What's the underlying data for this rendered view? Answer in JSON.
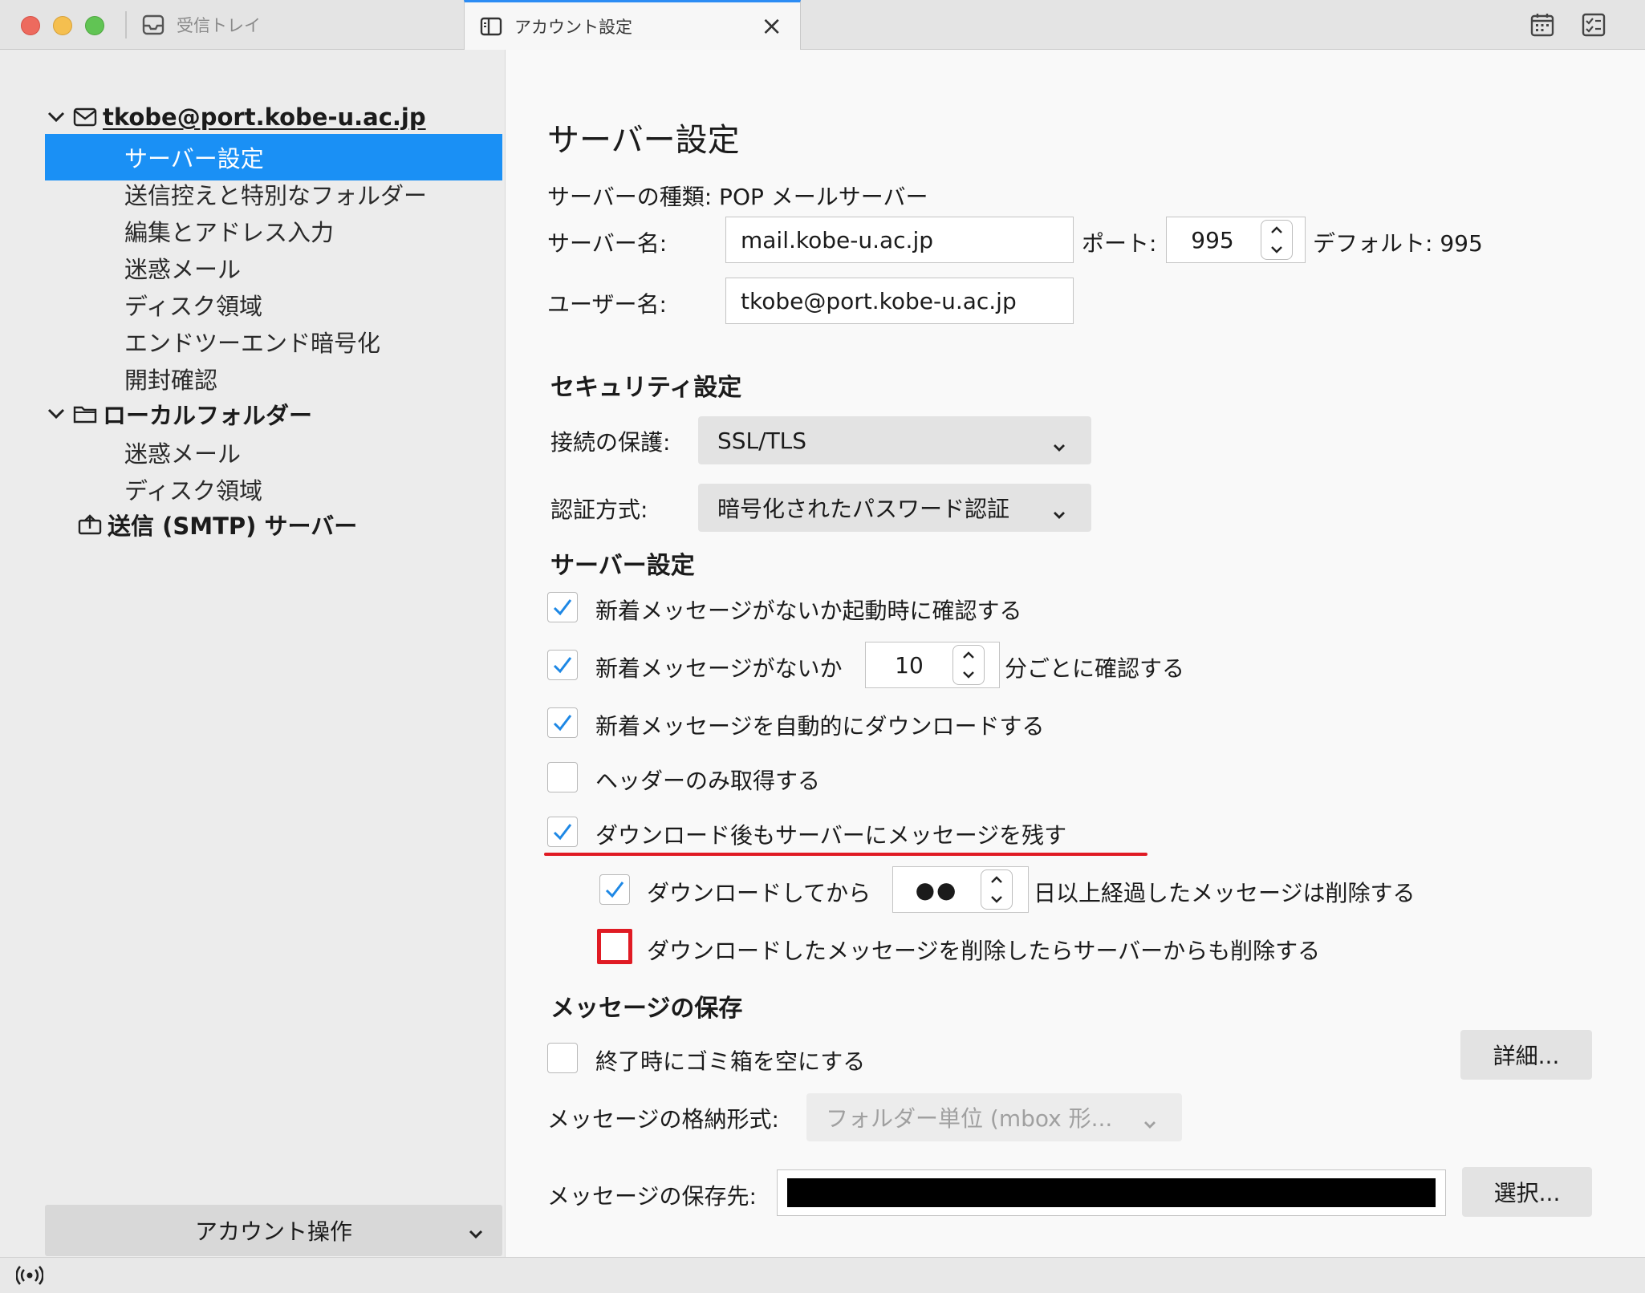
{
  "titlebar": {
    "tabs": [
      {
        "label": "受信トレイ",
        "icon": "inbox-icon"
      },
      {
        "label": "アカウント設定",
        "icon": "account-settings-icon",
        "active": true
      }
    ],
    "right_icons": [
      "calendar-icon",
      "tasks-icon"
    ]
  },
  "sidebar": {
    "account": "tkobe@port.kobe-u.ac.jp",
    "account_items": [
      "サーバー設定",
      "送信控えと特別なフォルダー",
      "編集とアドレス入力",
      "迷惑メール",
      "ディスク領域",
      "エンドツーエンド暗号化",
      "開封確認"
    ],
    "local_folders": "ローカルフォルダー",
    "local_items": [
      "迷惑メール",
      "ディスク領域"
    ],
    "smtp": "送信 (SMTP) サーバー",
    "account_actions": "アカウント操作"
  },
  "main": {
    "title": "サーバー設定",
    "server_type": "サーバーの種類: POP メールサーバー",
    "server_name_label": "サーバー名:",
    "server_name": "mail.kobe-u.ac.jp",
    "port_label": "ポート:",
    "port": "995",
    "default_port": "デフォルト: 995",
    "user_name_label": "ユーザー名:",
    "user_name": "tkobe@port.kobe-u.ac.jp",
    "security": {
      "heading": "セキュリティ設定",
      "connection_label": "接続の保護:",
      "connection_value": "SSL/TLS",
      "auth_label": "認証方式:",
      "auth_value": "暗号化されたパスワード認証"
    },
    "server_settings": {
      "heading": "サーバー設定",
      "check_on_startup": "新着メッセージがないか起動時に確認する",
      "check_every_pre": "新着メッセージがないか",
      "check_every_value": "10",
      "check_every_post": "分ごとに確認する",
      "auto_download": "新着メッセージを自動的にダウンロードする",
      "headers_only": "ヘッダーのみ取得する",
      "leave_on_server": "ダウンロード後もサーバーにメッセージを残す",
      "delete_after_pre": "ダウンロードしてから",
      "delete_after_value": "●●",
      "delete_after_post": "日以上経過したメッセージは削除する",
      "delete_from_server": "ダウンロードしたメッセージを削除したらサーバーからも削除する"
    },
    "storage": {
      "heading": "メッセージの保存",
      "empty_trash": "終了時にゴミ箱を空にする",
      "advanced_button": "詳細...",
      "format_label": "メッセージの格納形式:",
      "format_value": "フォルダー単位 (mbox 形...",
      "location_label": "メッセージの保存先:",
      "browse_button": "選択..."
    }
  },
  "colors": {
    "accent": "#1a90f5",
    "highlight_red": "#e01b24",
    "check_blue": "#1e88e5"
  }
}
